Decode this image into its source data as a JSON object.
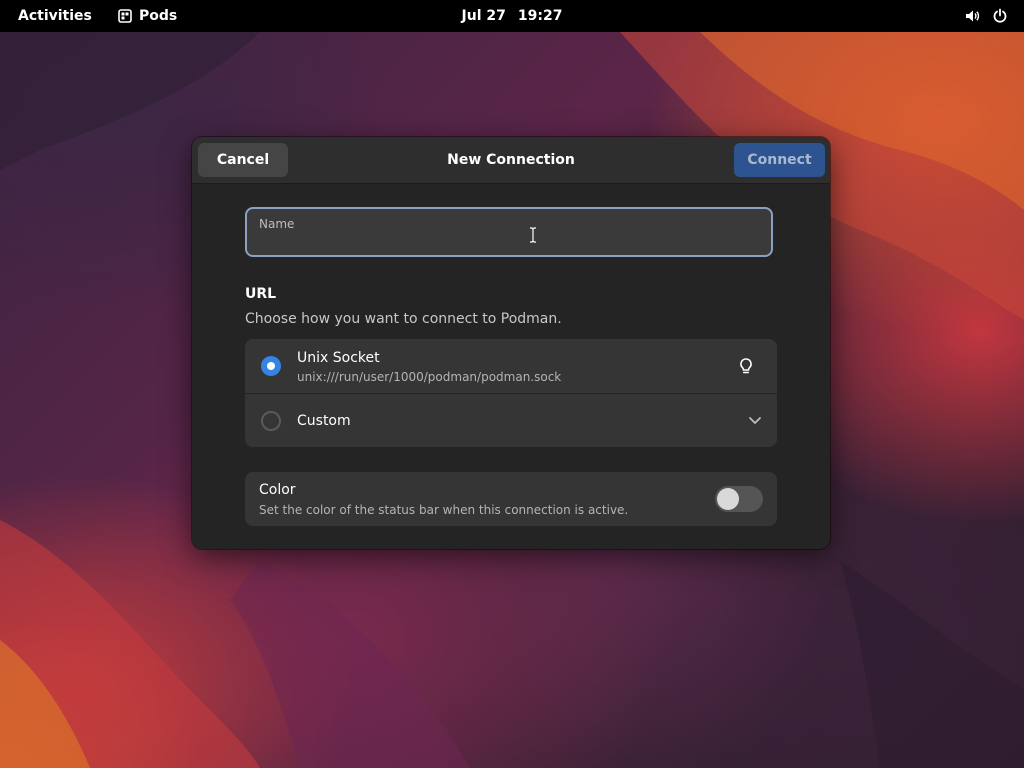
{
  "topbar": {
    "activities_label": "Activities",
    "app_name": "Pods",
    "app_icon": "pods-app-icon",
    "date": "Jul 27",
    "time": "19:27",
    "tray_icons": [
      "volume-icon",
      "power-icon"
    ]
  },
  "dialog": {
    "title": "New Connection",
    "cancel_label": "Cancel",
    "connect_label": "Connect",
    "name_field": {
      "label": "Name",
      "value": ""
    },
    "url_section": {
      "heading": "URL",
      "description": "Choose how you want to connect to Podman.",
      "options": [
        {
          "title": "Unix Socket",
          "subtitle": "unix:///run/user/1000/podman/podman.sock",
          "selected": true,
          "icon": "lightbulb-icon"
        },
        {
          "title": "Custom",
          "selected": false,
          "icon": "chevron-down-icon"
        }
      ]
    },
    "color_row": {
      "title": "Color",
      "subtitle": "Set the color of the status bar when this connection is active.",
      "enabled": false
    }
  },
  "colors": {
    "accent": "#3584e4",
    "connect_button": "#2d5390",
    "dialog_bg": "#242424",
    "row_bg": "#353535",
    "topbar_bg": "#000000"
  }
}
